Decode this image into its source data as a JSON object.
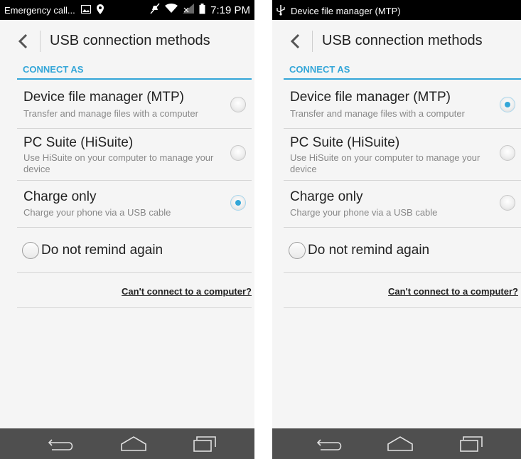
{
  "screens": [
    {
      "status": {
        "left_text": "Emergency call...",
        "time": "7:19 PM"
      },
      "title": "USB connection methods",
      "section": "CONNECT AS",
      "options": [
        {
          "title": "Device file manager (MTP)",
          "subtitle": "Transfer and manage files with a computer",
          "selected": false
        },
        {
          "title": "PC Suite (HiSuite)",
          "subtitle": "Use HiSuite on your computer to manage your device",
          "selected": false
        },
        {
          "title": "Charge only",
          "subtitle": "Charge your phone via a USB cable",
          "selected": true
        }
      ],
      "remind_label": "Do not remind again",
      "help_link": "Can't connect to a computer?"
    },
    {
      "status": {
        "left_text": "Device file manager (MTP)"
      },
      "title": "USB connection methods",
      "section": "CONNECT AS",
      "options": [
        {
          "title": "Device file manager (MTP)",
          "subtitle": "Transfer and manage files with a computer",
          "selected": true
        },
        {
          "title": "PC Suite (HiSuite)",
          "subtitle": "Use HiSuite on your computer to manage your device",
          "selected": false
        },
        {
          "title": "Charge only",
          "subtitle": "Charge your phone via a USB cable",
          "selected": false
        }
      ],
      "remind_label": "Do not remind again",
      "help_link": "Can't connect to a computer?"
    }
  ],
  "icons": {
    "status_left": [
      "image-icon",
      "location-pin-icon"
    ],
    "status_right": [
      "mute-icon",
      "wifi-icon",
      "signal-icon",
      "battery-icon"
    ],
    "status_right_screen2": [
      "usb-icon"
    ],
    "nav": [
      "back-nav-icon",
      "home-nav-icon",
      "recents-nav-icon"
    ]
  },
  "colors": {
    "accent": "#33a6d8",
    "status_bar": "#000000",
    "nav_bar": "#4f4f4f",
    "background": "#f5f5f5"
  }
}
